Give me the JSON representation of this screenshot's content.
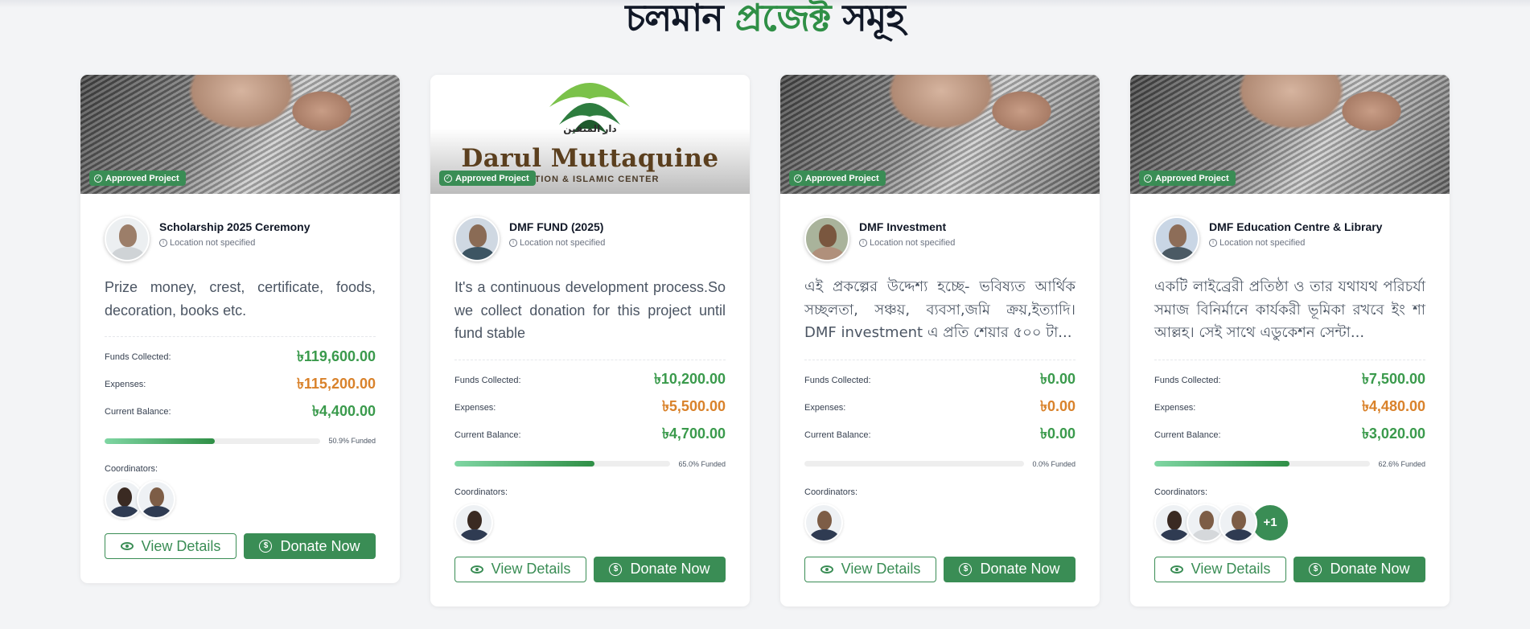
{
  "page": {
    "title_part1": "চলমান",
    "title_accent": "প্রজেক্ট",
    "title_part2": "সমূহ"
  },
  "labels": {
    "badge": "Approved Project",
    "funds_collected": "Funds Collected:",
    "expenses": "Expenses:",
    "current_balance": "Current Balance:",
    "coordinators": "Coordinators:",
    "view_details": "View Details",
    "donate_now": "Donate Now",
    "location": "Location not specified"
  },
  "colors": {
    "accent": "#3a8d55",
    "money_green": "#3a9a4c",
    "money_orange": "#d9822b"
  },
  "banner_logo": {
    "arabic": "دار المتقين",
    "name": "Darul Muttaquine",
    "subtitle": "DATION & ISLAMIC CENTER"
  },
  "projects": [
    {
      "title": "Scholarship 2025 Ceremony",
      "description": "Prize money, crest, certificate, foods, decoration, books etc.",
      "funds_collected": "৳119,600.00",
      "expenses": "৳115,200.00",
      "current_balance": "৳4,400.00",
      "progress_percent": 50.9,
      "progress_label": "50.9% Funded",
      "coordinator_count_extra": ""
    },
    {
      "title": "DMF FUND (2025)",
      "description": "It's a continuous development process.So we collect donation for this project until fund stable",
      "funds_collected": "৳10,200.00",
      "expenses": "৳5,500.00",
      "current_balance": "৳4,700.00",
      "progress_percent": 65.0,
      "progress_label": "65.0% Funded",
      "coordinator_count_extra": ""
    },
    {
      "title": "DMF Investment",
      "description": "এই প্রকল্পের উদ্দেশ্য হচ্ছে- ভবিষ্যত আর্থিক সচ্ছলতা, সঞ্চয়, ব্যবসা,জমি ক্রয়,ইত্যাদি। DMF investment এ প্রতি শেয়ার ৫০০ টা...",
      "funds_collected": "৳0.00",
      "expenses": "৳0.00",
      "current_balance": "৳0.00",
      "progress_percent": 0.0,
      "progress_label": "0.0% Funded",
      "coordinator_count_extra": ""
    },
    {
      "title": "DMF Education Centre & Library",
      "description": "একটি লাইব্রেরী প্রতিষ্ঠা ও তার যথাযথ পরিচর্যা সমাজ বিনির্মানে কার্যকরী ভূমিকা রখবে ইং শা আল্লহ। সেই সাথে এডুকেশন সেন্টা...",
      "funds_collected": "৳7,500.00",
      "expenses": "৳4,480.00",
      "current_balance": "৳3,020.00",
      "progress_percent": 62.6,
      "progress_label": "62.6% Funded",
      "coordinator_count_extra": "+1"
    }
  ]
}
